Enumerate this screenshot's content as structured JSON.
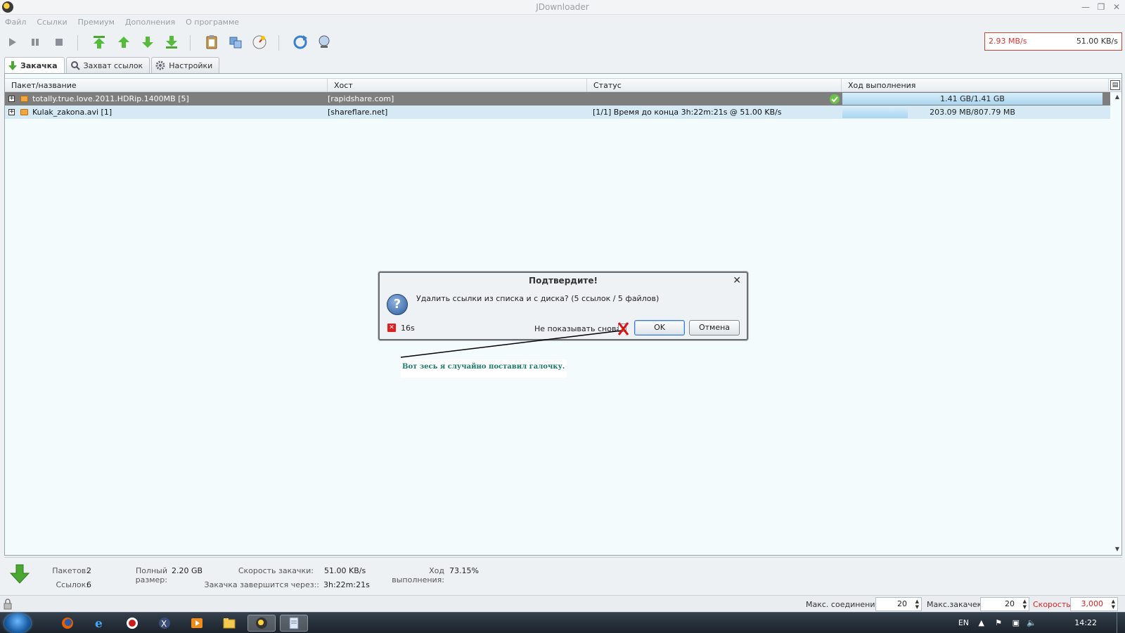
{
  "window": {
    "title": "JDownloader"
  },
  "menu": [
    "Файл",
    "Ссылки",
    "Премиум",
    "Дополнения",
    "О программе"
  ],
  "toolbar": {
    "speed_current": "2.93 MB/s",
    "speed_limit": "51.00 KB/s"
  },
  "tabs": [
    {
      "label": "Закачка",
      "icon": "download-arrow-icon",
      "active": true
    },
    {
      "label": "Захват ссылок",
      "icon": "link-grabber-icon",
      "active": false
    },
    {
      "label": "Настройки",
      "icon": "gear-icon",
      "active": false
    }
  ],
  "table": {
    "columns": [
      "Пакет/название",
      "Хост",
      "Статус",
      "Ход выполнения"
    ],
    "rows": [
      {
        "name": "totally.true.love.2011.HDRip.1400MB [5]",
        "host": "[rapidshare.com]",
        "status": "",
        "progress_text": "1.41 GB/1.41 GB",
        "progress": 1.0,
        "selected": true
      },
      {
        "name": "Kulak_zakona.avi [1]",
        "host": "[shareflare.net]",
        "status": "[1/1] Время до конца 3h:22m:21s @ 51.00 KB/s",
        "progress_text": "203.09 MB/807.79 MB",
        "progress": 0.251,
        "selected": false
      }
    ]
  },
  "dialog": {
    "title": "Подтвердите!",
    "message": "Удалить ссылки из списка и с диска? (5 ссылок /  5 файлов)",
    "timer": "16s",
    "dont_show": "Не показывать снова",
    "ok": "OK",
    "cancel": "Отмена"
  },
  "annotation": "Вот зесь я случайно поставил галочку.",
  "info": {
    "packages_label": "Пакетов:",
    "packages": "2",
    "links_label": "Ссылок:",
    "links": "6",
    "total_size_label": "Полный размер:",
    "total_size": "2.20 GB",
    "dl_speed_label": "Скорость закачки:",
    "dl_speed": "51.00 KB/s",
    "eta_label": "Закачка завершится через::",
    "eta": "3h:22m:21s",
    "progress_label": "Ход выполнения:",
    "progress": "73.15%"
  },
  "statusbar": {
    "max_conn_label": "Макс. соединений",
    "max_conn": "20",
    "max_dl_label": "Макс.закачек",
    "max_dl": "20",
    "speed_label": "Скорость",
    "speed": "3,000"
  },
  "taskbar": {
    "lang": "EN",
    "time": "14:22"
  }
}
